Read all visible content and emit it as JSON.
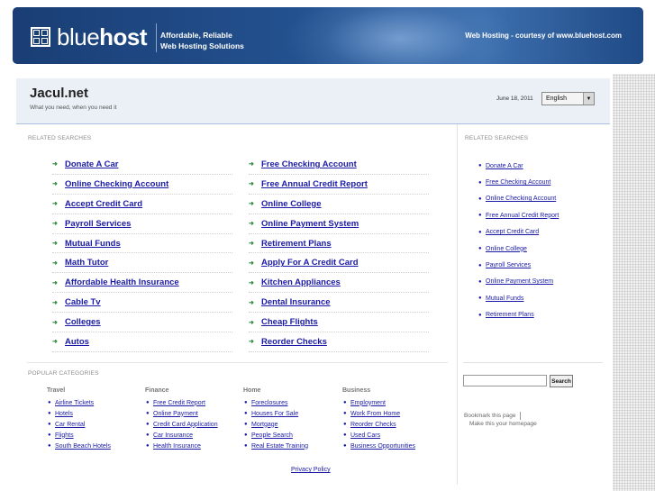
{
  "banner": {
    "logo_light": "blue",
    "logo_bold": "host",
    "tagline_line1": "Affordable, Reliable",
    "tagline_line2": "Web Hosting Solutions",
    "courtesy": "Web Hosting - courtesy of www.bluehost.com"
  },
  "site": {
    "title": "Jacul.net",
    "subtitle": "What you need, when you need it",
    "date": "June 18, 2011",
    "language": "English"
  },
  "main": {
    "related_label": "RELATED SEARCHES",
    "col1": [
      "Donate A Car",
      "Online Checking Account",
      "Accept Credit Card",
      "Payroll Services",
      "Mutual Funds",
      "Math Tutor",
      "Affordable Health Insurance",
      "Cable Tv",
      "Colleges",
      "Autos"
    ],
    "col2": [
      "Free Checking Account",
      "Free Annual Credit Report",
      "Online College",
      "Online Payment System",
      "Retirement Plans",
      "Apply For A Credit Card",
      "Kitchen Appliances",
      "Dental Insurance",
      "Cheap Flights",
      "Reorder Checks"
    ]
  },
  "sidebar": {
    "related_label": "RELATED SEARCHES",
    "links": [
      "Donate A Car",
      "Free Checking Account",
      "Online Checking Account",
      "Free Annual Credit Report",
      "Accept Credit Card",
      "Online College",
      "Payroll Services",
      "Online Payment System",
      "Mutual Funds",
      "Retirement Plans"
    ],
    "search_button": "Search",
    "bookmark": "Bookmark this page",
    "homepage": "Make this your homepage"
  },
  "popular": {
    "label": "POPULAR CATEGORIES",
    "categories": [
      {
        "title": "Travel",
        "items": [
          "Airline Tickets",
          "Hotels",
          "Car Rental",
          "Flights",
          "South Beach Hotels"
        ]
      },
      {
        "title": "Finance",
        "items": [
          "Free Credit Report",
          "Online Payment",
          "Credit Card Application",
          "Car Insurance",
          "Health Insurance"
        ]
      },
      {
        "title": "Home",
        "items": [
          "Foreclosures",
          "Houses For Sale",
          "Mortgage",
          "People Search",
          "Real Estate Training"
        ]
      },
      {
        "title": "Business",
        "items": [
          "Employment",
          "Work From Home",
          "Reorder Checks",
          "Used Cars",
          "Business Opportunities"
        ]
      }
    ]
  },
  "footer": {
    "privacy": "Privacy Policy"
  }
}
